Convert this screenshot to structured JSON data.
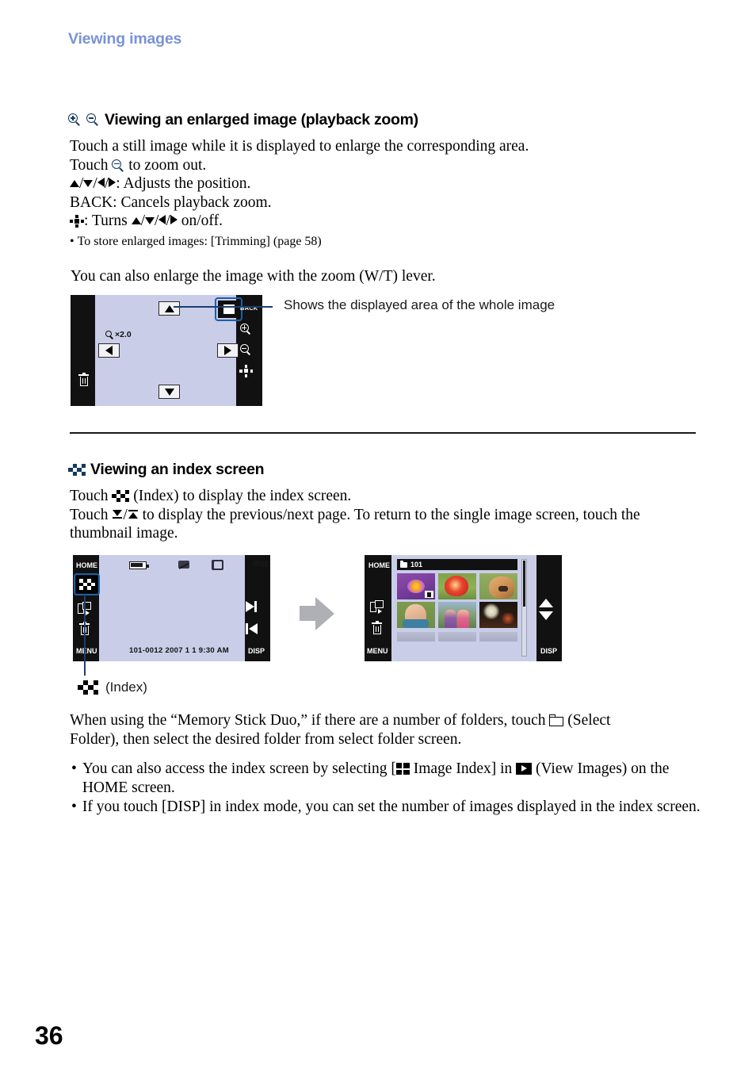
{
  "header": {
    "running_title": "Viewing images",
    "accent_color": "#7a93d6"
  },
  "page_number": "36",
  "section1": {
    "icons": [
      "zoom-in-icon",
      "zoom-out-icon"
    ],
    "heading": "Viewing an enlarged image (playback zoom)",
    "line1": "Touch a still image while it is displayed to enlarge the corresponding area.",
    "line2_pre": "Touch",
    "line2_post": "to zoom out.",
    "line3": ": Adjusts the position.",
    "line4": "BACK: Cancels playback zoom.",
    "line5_pre": ": Turns",
    "line5_post": "on/off.",
    "bullet1": "To store enlarged images: [Trimming] (page 58)",
    "paragraph": "You can also enlarge the image with the zoom (W/T) lever.",
    "callout": "Shows the displayed area of the whole image"
  },
  "lcd_zoom": {
    "zoom_label": "×2.0",
    "back_label": "BACK",
    "buttons": [
      "up-arrow-button",
      "down-arrow-button",
      "left-arrow-button",
      "right-arrow-button",
      "display-area-button"
    ],
    "rail_icons": [
      "zoom-in-icon",
      "zoom-out-icon",
      "dpad-toggle-icon",
      "delete-icon"
    ],
    "screen_color": "#c9cde8",
    "bezel_color": "#111111",
    "highlight_color": "#1d5fa8"
  },
  "section2": {
    "icon": "index-icon",
    "heading": "Viewing an index screen",
    "line1_pre": "Touch",
    "line1_post": "(Index) to display the index screen.",
    "line2_pre": "Touch",
    "line2_post": "to display the previous/next page. To return to the single image screen, touch the",
    "line2_cont": "thumbnail image.",
    "legend_label": "(Index)",
    "paragraph_a": "When using the “Memory Stick Duo,” if there are a number of folders, touch",
    "paragraph_b": "(Select",
    "paragraph_c": "Folder), then select the desired folder from select folder screen.",
    "bullet1_a": "You can also access the index screen by selecting [",
    "bullet1_b": "Image Index] in",
    "bullet1_c": "(View Images) on",
    "bullet1_d": "the HOME screen.",
    "bullet2": "If you touch [DISP] in index mode, you can set the number of images displayed in the index",
    "bullet2_cont": "screen."
  },
  "lcd_single": {
    "home_label": "HOME",
    "menu_label": "MENU",
    "disp_label": "DISP",
    "counter": "9/12",
    "file_info": "101-0012   2007 1 1 9:30 AM",
    "icons": [
      "battery-icon",
      "image-size-icon",
      "memory-card-icon",
      "index-button",
      "slideshow-icon",
      "delete-icon",
      "next-image-icon",
      "previous-image-icon"
    ]
  },
  "lcd_index": {
    "home_label": "HOME",
    "menu_label": "MENU",
    "disp_label": "DISP",
    "folder_label": "101",
    "icons": [
      "folder-icon",
      "slideshow-icon",
      "delete-icon",
      "page-up-icon",
      "page-down-icon",
      "scrollbar"
    ],
    "thumbnails": [
      {
        "name": "lotus-flower",
        "badge": "movie-badge"
      },
      {
        "name": "red-flower",
        "badge": ""
      },
      {
        "name": "dog",
        "badge": ""
      },
      {
        "name": "girl-portrait",
        "badge": ""
      },
      {
        "name": "two-girls",
        "badge": ""
      },
      {
        "name": "night-trees",
        "badge": ""
      }
    ]
  }
}
